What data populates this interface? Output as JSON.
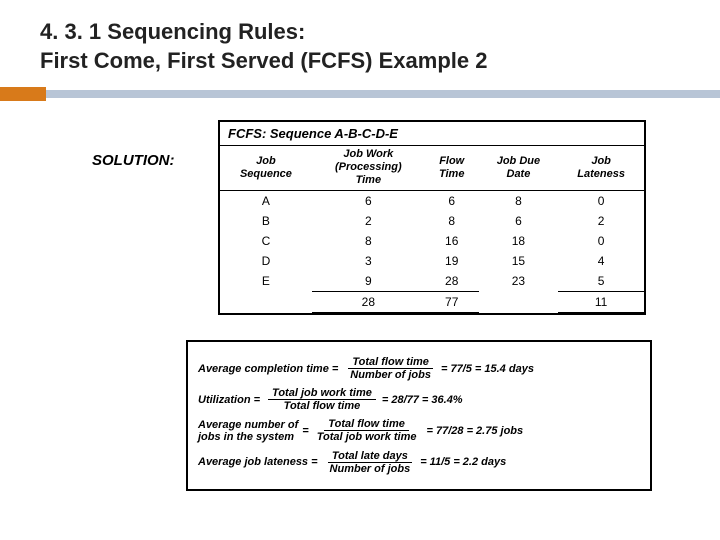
{
  "title_line1": "4. 3. 1 Sequencing Rules:",
  "title_line2": "First Come, First Served (FCFS) Example 2",
  "solution_label": "SOLUTION:",
  "table": {
    "caption": "FCFS: Sequence A-B-C-D-E",
    "headers": {
      "c1a": "Job",
      "c1b": "Sequence",
      "c2a": "Job Work",
      "c2b": "(Processing)",
      "c2c": "Time",
      "c3a": "Flow",
      "c3b": "Time",
      "c4a": "Job Due",
      "c4b": "Date",
      "c5a": "Job",
      "c5b": "Lateness"
    },
    "rows": [
      {
        "job": "A",
        "work": "6",
        "flow": "6",
        "due": "8",
        "late": "0"
      },
      {
        "job": "B",
        "work": "2",
        "flow": "8",
        "due": "6",
        "late": "2"
      },
      {
        "job": "C",
        "work": "8",
        "flow": "16",
        "due": "18",
        "late": "0"
      },
      {
        "job": "D",
        "work": "3",
        "flow": "19",
        "due": "15",
        "late": "4"
      },
      {
        "job": "E",
        "work": "9",
        "flow": "28",
        "due": "23",
        "late": "5"
      }
    ],
    "totals": {
      "work": "28",
      "flow": "77",
      "late": "11"
    }
  },
  "formulas": {
    "f1": {
      "lhs": "Average completion time =",
      "num": "Total flow time",
      "den": "Number of jobs",
      "rhs": "= 77/5 = 15.4 days"
    },
    "f2": {
      "lhs": "Utilization =",
      "num": "Total job work time",
      "den": "Total flow time",
      "rhs": "= 28/77 = 36.4%"
    },
    "f3": {
      "lhs1": "Average number of",
      "lhs2": "jobs in the system",
      "eq": "=",
      "num": "Total flow time",
      "den": "Total job work time",
      "rhs": "= 77/28 = 2.75 jobs"
    },
    "f4": {
      "lhs": "Average job lateness =",
      "num": "Total late days",
      "den": "Number of jobs",
      "rhs": "= 11/5 = 2.2 days"
    }
  }
}
